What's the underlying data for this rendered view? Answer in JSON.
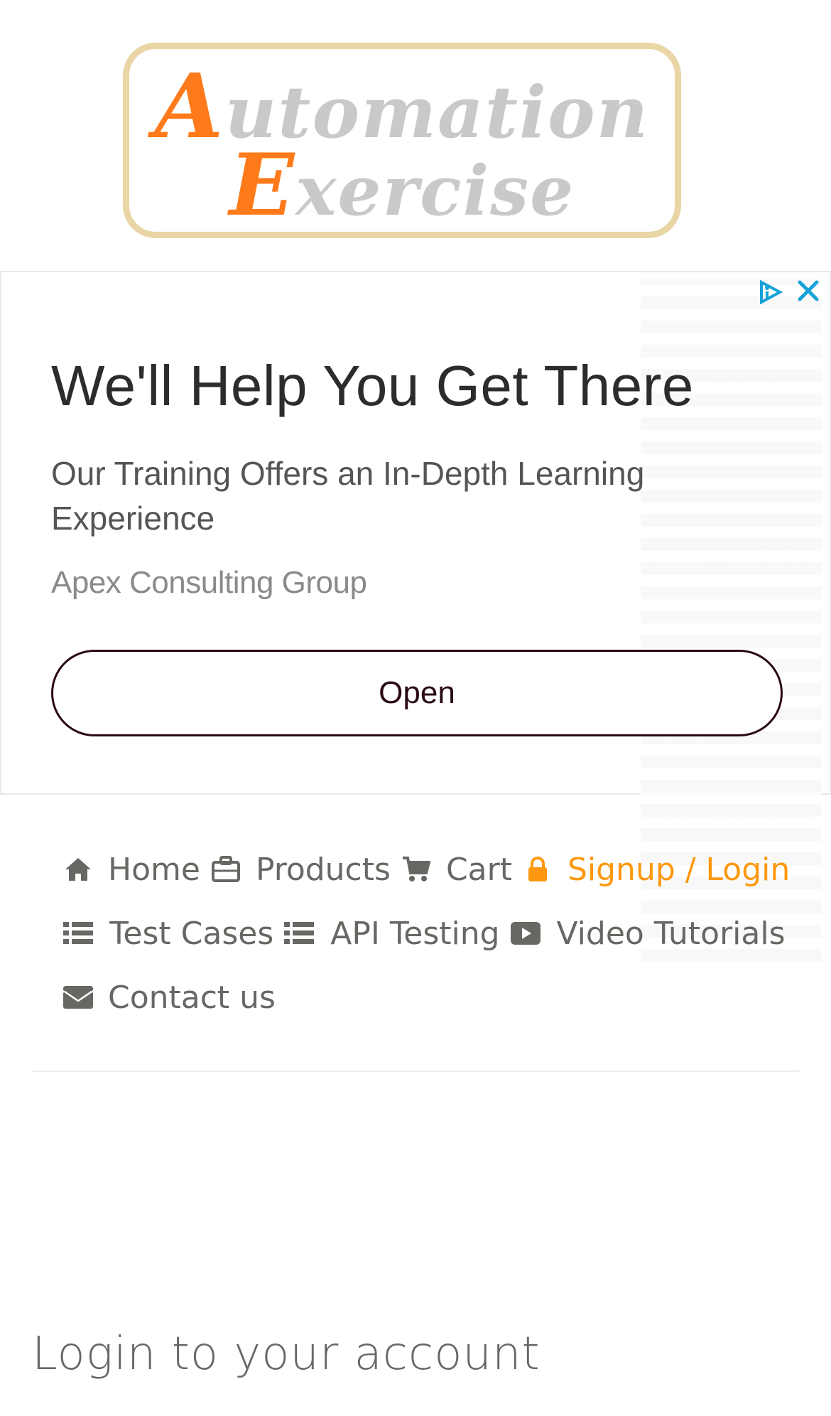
{
  "logo": {
    "line1_cap": "A",
    "line1_rest": "utomation",
    "line2_cap": "E",
    "line2_rest": "xercise"
  },
  "ad": {
    "headline": "We'll Help You Get There",
    "subline": "Our Training Offers an In-Depth Learning Experience",
    "advertiser": "Apex Consulting Group",
    "open_label": "Open",
    "icons": [
      "ad-choices-icon",
      "close-icon"
    ]
  },
  "nav": {
    "items": [
      {
        "label": "Home",
        "icon": "home-icon"
      },
      {
        "label": "Products",
        "icon": "products-icon"
      },
      {
        "label": "Cart",
        "icon": "cart-icon"
      },
      {
        "label": "Signup / Login",
        "icon": "lock-icon",
        "active": true
      },
      {
        "label": "Test Cases",
        "icon": "list-icon"
      },
      {
        "label": "API Testing",
        "icon": "list-icon"
      },
      {
        "label": "Video Tutorials",
        "icon": "youtube-play-icon"
      },
      {
        "label": "Contact us",
        "icon": "envelope-icon"
      }
    ]
  },
  "login": {
    "title": "Login to your account"
  },
  "colors": {
    "accent": "#fe980f",
    "logo_orange": "#ff7a1a",
    "logo_grey": "#c9c9c9",
    "logo_border": "#e9d5a6",
    "nav_text": "#696763",
    "ad_icon": "#16a3d8"
  }
}
